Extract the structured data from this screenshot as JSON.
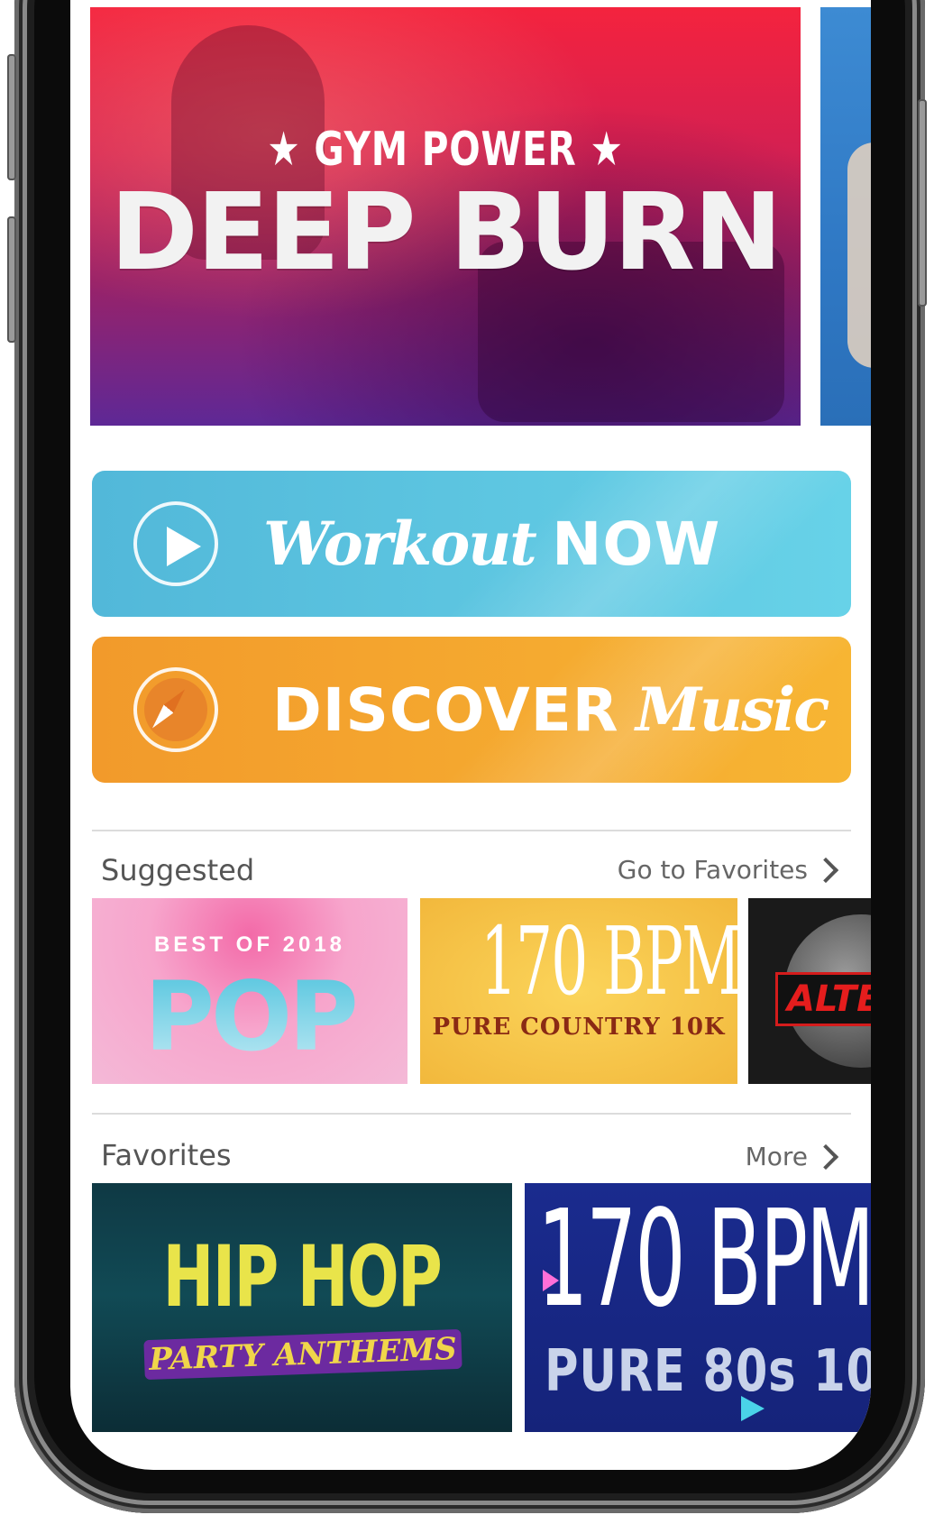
{
  "hero": {
    "eyebrow": "★ GYM POWER ★",
    "title": "DEEP BURN"
  },
  "actions": {
    "workout": {
      "script": "Workout",
      "caps": "NOW",
      "color": "#5ec6e2"
    },
    "discover": {
      "caps": "DISCOVER",
      "script": "Music",
      "color": "#f4a62e"
    }
  },
  "suggested": {
    "title": "Suggested",
    "link": "Go to Favorites",
    "tiles": [
      {
        "kind": "pop",
        "sub": "BEST OF 2018",
        "main": "POP"
      },
      {
        "kind": "country",
        "main": "170 BPM",
        "sub": "PURE COUNTRY 10K"
      },
      {
        "kind": "alt",
        "main": "ALTE"
      }
    ]
  },
  "favorites": {
    "title": "Favorites",
    "link": "More",
    "tiles": [
      {
        "kind": "hiphop",
        "main": "HIP HOP",
        "sub": "PARTY ANTHEMS"
      },
      {
        "kind": "eighties",
        "main": "170 BPM",
        "sub": "PURE 80s 10"
      }
    ]
  }
}
